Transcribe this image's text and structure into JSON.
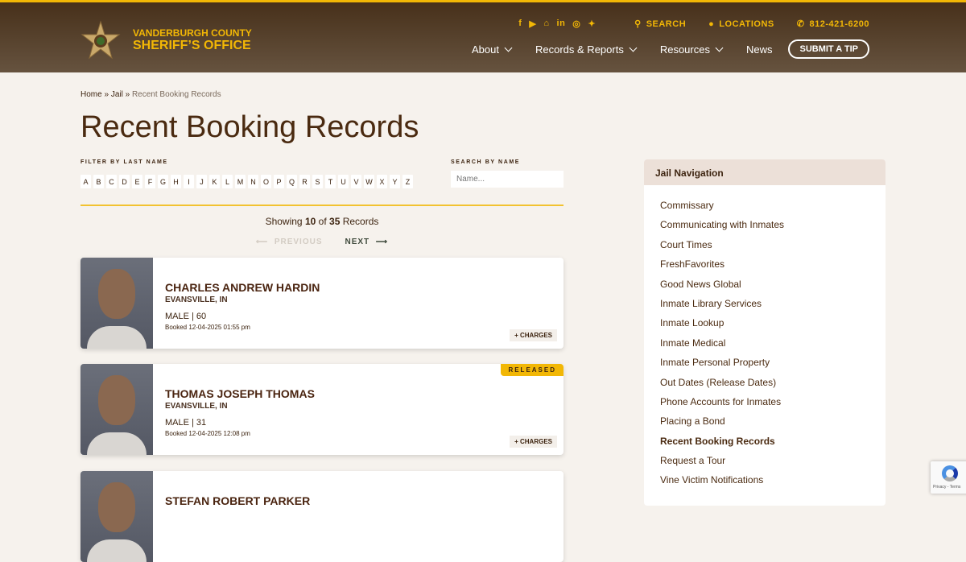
{
  "header": {
    "logo_line1": "VANDERBURGH COUNTY",
    "logo_line2": "SHERIFF’S OFFICE",
    "social": [
      "facebook-icon",
      "youtube-icon",
      "home-icon",
      "linkedin-icon",
      "instagram-icon",
      "bluesky-icon"
    ],
    "search": "SEARCH",
    "locations": "LOCATIONS",
    "phone": "812-421-6200",
    "nav": [
      "About",
      "Records & Reports",
      "Resources",
      "News"
    ],
    "tip": "SUBMIT A TIP"
  },
  "breadcrumb": {
    "home": "Home",
    "jail": "Jail",
    "sep": "»",
    "current": "Recent Booking Records"
  },
  "title": "Recent Booking Records",
  "filter": {
    "label": "FILTER BY LAST NAME",
    "letters": [
      "A",
      "B",
      "C",
      "D",
      "E",
      "F",
      "G",
      "H",
      "I",
      "J",
      "K",
      "L",
      "M",
      "N",
      "O",
      "P",
      "Q",
      "R",
      "S",
      "T",
      "U",
      "V",
      "W",
      "X",
      "Y",
      "Z"
    ]
  },
  "search": {
    "label": "SEARCH BY NAME",
    "placeholder": "Name..."
  },
  "showing": {
    "pre": "Showing",
    "count": "10",
    "of": "of",
    "total": "35",
    "post": "Records"
  },
  "pager": {
    "prev": "PREVIOUS",
    "next": "NEXT"
  },
  "records": [
    {
      "name": "CHARLES ANDREW HARDIN",
      "city": "EVANSVILLE, IN",
      "sex_age": "MALE | 60",
      "booked": "Booked 12-04-2025 01:55 pm",
      "charges": "+ CHARGES",
      "status": ""
    },
    {
      "name": "THOMAS JOSEPH THOMAS",
      "city": "EVANSVILLE, IN",
      "sex_age": "MALE | 31",
      "booked": "Booked 12-04-2025 12:08 pm",
      "charges": "+ CHARGES",
      "status": "RELEASED"
    },
    {
      "name": "STEFAN ROBERT PARKER",
      "city": "",
      "sex_age": "",
      "booked": "",
      "charges": "",
      "status": ""
    }
  ],
  "sidebar": {
    "title": "Jail Navigation",
    "items": [
      "Commissary",
      "Communicating with Inmates",
      "Court Times",
      "FreshFavorites",
      "Good News Global",
      "Inmate Library Services",
      "Inmate Lookup",
      "Inmate Medical",
      "Inmate Personal Property",
      "Out Dates (Release Dates)",
      "Phone Accounts for Inmates",
      "Placing a Bond",
      "Recent Booking Records",
      "Request a Tour",
      "Vine Victim Notifications"
    ],
    "active": "Recent Booking Records"
  },
  "recaptcha": {
    "text": "Privacy - Terms"
  }
}
